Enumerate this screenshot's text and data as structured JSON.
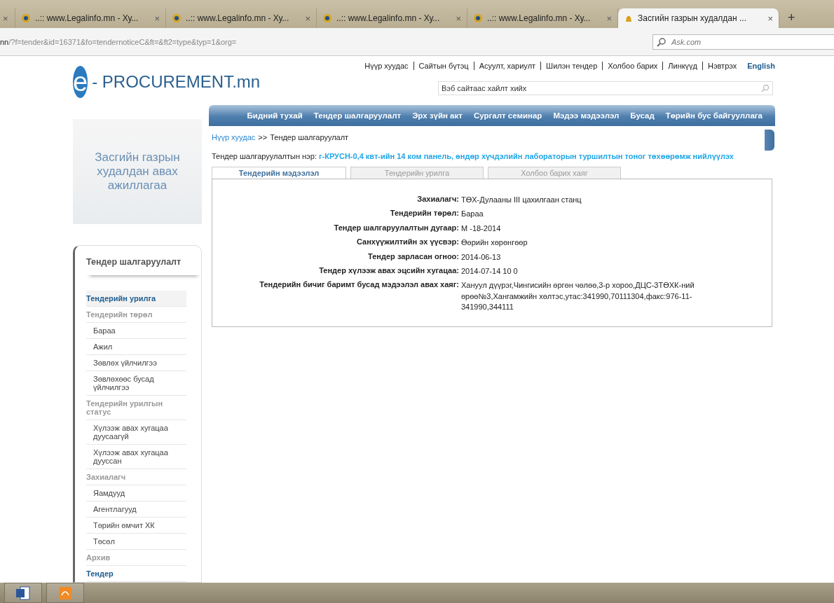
{
  "browser_tabs": [
    {
      "selected": false
    },
    {
      "title": "..:: www.Legalinfo.mn - Ху...",
      "selected": false
    },
    {
      "title": "..:: www.Legalinfo.mn - Ху...",
      "selected": false
    },
    {
      "title": "..:: www.Legalinfo.mn - Ху...",
      "selected": false
    },
    {
      "title": "..:: www.Legalinfo.mn - Ху...",
      "selected": false
    },
    {
      "title": "Засгийн газрын худалдан ...",
      "selected": true
    }
  ],
  "new_tab": "+",
  "tab_close": "×",
  "address_bar": {
    "host_tail": "nn",
    "path": "/?f=tender&id=16371&fo=tendernoticeC&ft=&ft2=type&typ=1&org="
  },
  "browser_search": {
    "placeholder": "Ask.com"
  },
  "top_links": [
    "Нүүр хуудас",
    "Сайтын бүтэц",
    "Асуулт, хариулт",
    "Шилэн тендер",
    "Холбоо барих",
    "Линкүүд",
    "Нэвтрэх"
  ],
  "language_link": "English",
  "logo": {
    "letter": "e",
    "text": "- PROCUREMENT.mn"
  },
  "site_search": {
    "value": "Вэб сайтаас хайлт хийх"
  },
  "banner_text": "Засгийн газрын худалдан авах ажиллагаа",
  "nav": [
    "Бидний тухай",
    "Тендер шалгаруулалт",
    "Эрх зүйн акт",
    "Сургалт семинар",
    "Мэдээ мэдээлэл",
    "Бусад",
    "Төрийн бус байгууллага"
  ],
  "sidebar": {
    "title": "Тендер шалгаруулалт",
    "items": [
      {
        "label": "Тендерийн урилга",
        "kind": "link",
        "selected": true
      },
      {
        "label": "Тендерийн төрөл",
        "kind": "group",
        "selected": false
      },
      {
        "label": "Бараа",
        "kind": "item",
        "selected": false
      },
      {
        "label": "Ажил",
        "kind": "item",
        "selected": false
      },
      {
        "label": "Зөвлөх үйлчилгээ",
        "kind": "item",
        "selected": false
      },
      {
        "label": "Зөвлөхөөс бусад үйлчилгээ",
        "kind": "item",
        "selected": false
      },
      {
        "label": "Тендерийн урилгын статус",
        "kind": "group",
        "selected": false
      },
      {
        "label": "Хүлээж авах хугацаа дуусаагүй",
        "kind": "item",
        "selected": false
      },
      {
        "label": "Хүлээж авах хугацаа дууссан",
        "kind": "item",
        "selected": false
      },
      {
        "label": "Захиалагч",
        "kind": "group",
        "selected": false
      },
      {
        "label": "Яамдууд",
        "kind": "item",
        "selected": false
      },
      {
        "label": "Агентлагууд",
        "kind": "item",
        "selected": false
      },
      {
        "label": "Төрийн өмчит ХК",
        "kind": "item",
        "selected": false
      },
      {
        "label": "Төсөл",
        "kind": "item",
        "selected": false
      },
      {
        "label": "Архив",
        "kind": "group",
        "selected": false
      },
      {
        "label": "Тендер",
        "kind": "link",
        "selected": false
      }
    ]
  },
  "breadcrumb": {
    "link": "Нүүр хуудас",
    "separator": ">>",
    "current": "Тендер шалгаруулалт"
  },
  "tender_name": "Тендер шалгаруулалтын нэр: **г-КРУСН-0,4 квт-ийн 14 ком панель, өндөр хүчдэлийн лабораторын туршилтын тоног төхөөрөмж нийлүүлэх**",
  "tabs": [
    {
      "label": "Тендерийн мэдээлэл",
      "selected": true
    },
    {
      "label": "Тендерийн урилга",
      "selected": false
    },
    {
      "label": "Холбоо барих хаяг",
      "selected": false
    }
  ],
  "details": [
    {
      "label": "Захиалагч:",
      "value": "ТӨХ-Дулааны III цахилгаан станц"
    },
    {
      "label": "Тендерийн төрөл:",
      "value": "Бараа"
    },
    {
      "label": "Тендер шалгаруулалтын дугаар:",
      "value": "М -18-2014"
    },
    {
      "label": "Санхүүжилтийн эх үүсвэр:",
      "value": "Өөрийн хөрөнгөөр"
    },
    {
      "label": "Тендер зарласан огноо:",
      "value": "2014-06-13"
    },
    {
      "label": "Тендер хүлээж авах эцсийн хугацаа:",
      "value": "2014-07-14 10 0"
    },
    {
      "label": "Тендерийн бичиг баримт бусад мэдээлэл авах хаяг:",
      "value": "Хануул дүүрэг,Чингисийн өргөн чөлөө,3-р хороо,ДЦС-3ТӨХК-ний өрөө№3,Хангамжийн хөлтэс,утас:341990,70111304,факс:976-11-341990,344111"
    }
  ]
}
